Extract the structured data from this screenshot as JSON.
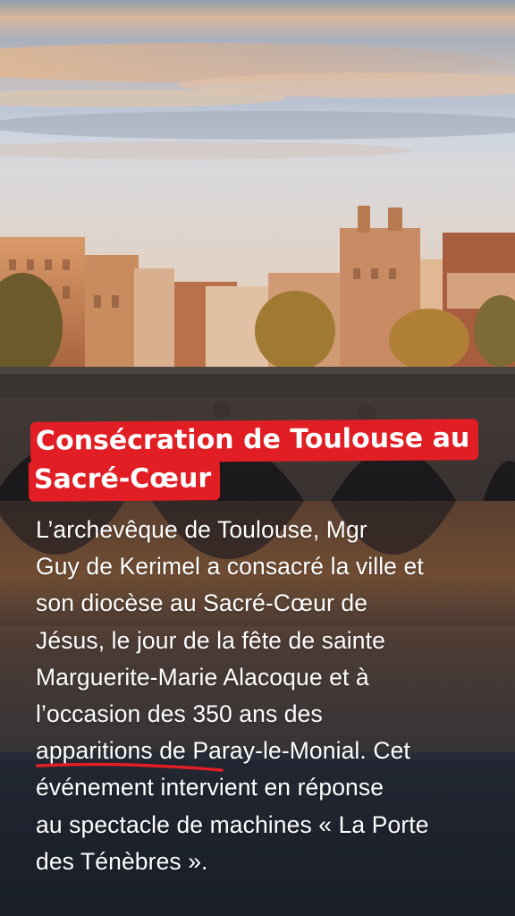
{
  "title": {
    "line1": "Consécration de Toulouse au",
    "line2": "Sacré-Cœur"
  },
  "body": {
    "lines": [
      " L’archevêque de Toulouse, Mgr",
      "Guy de Kerimel a consacré la ville et",
      "son diocèse au Sacré-Cœur de",
      "Jésus, le jour de la fête de sainte",
      "Marguerite-Marie Alacoque et à",
      "l’occasion des 350 ans des",
      "apparitions de Paray-le-Monial. Cet",
      "événement intervient en réponse",
      "au spectacle de machines « La Porte",
      "des Ténèbres »."
    ]
  },
  "colors": {
    "accent": "#e01e24",
    "text": "#ffffff"
  },
  "image": {
    "subject": "Toulouse riverside with stone arched bridge at sunset"
  }
}
